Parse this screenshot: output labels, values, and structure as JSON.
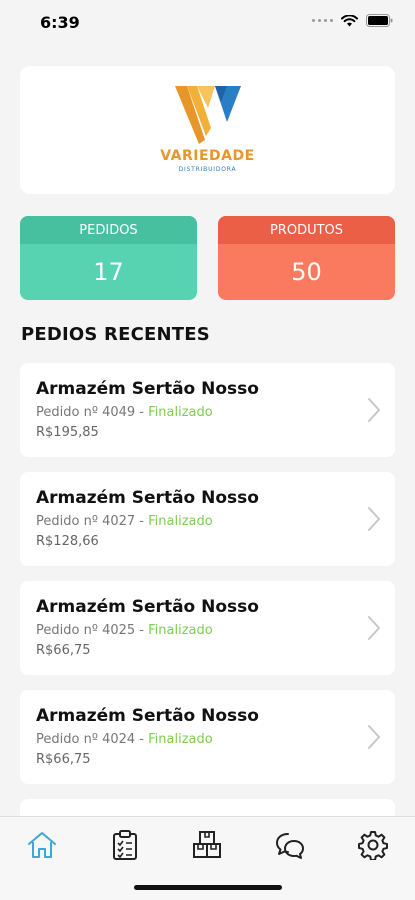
{
  "status_bar": {
    "time": "6:39"
  },
  "brand": {
    "name": "VARIEDADE",
    "subtitle": "DISTRIBUIDORA"
  },
  "stats": {
    "orders": {
      "label": "PEDIDOS",
      "value": "17"
    },
    "products": {
      "label": "PRODUTOS",
      "value": "50"
    }
  },
  "recent": {
    "title": "PEDIOS RECENTES",
    "items": [
      {
        "store": "Armazém Sertão Nosso",
        "order": "Pedido nº 4049",
        "separator": " - ",
        "status": "Finalizado",
        "price": "R$195,85"
      },
      {
        "store": "Armazém Sertão Nosso",
        "order": "Pedido nº 4027",
        "separator": " - ",
        "status": "Finalizado",
        "price": "R$128,66"
      },
      {
        "store": "Armazém Sertão Nosso",
        "order": "Pedido nº 4025",
        "separator": " - ",
        "status": "Finalizado",
        "price": "R$66,75"
      },
      {
        "store": "Armazém Sertão Nosso",
        "order": "Pedido nº 4024",
        "separator": " - ",
        "status": "Finalizado",
        "price": "R$66,75"
      }
    ]
  },
  "tabs": [
    {
      "icon": "home-icon",
      "active": true
    },
    {
      "icon": "clipboard-icon",
      "active": false
    },
    {
      "icon": "boxes-icon",
      "active": false
    },
    {
      "icon": "chat-icon",
      "active": false
    },
    {
      "icon": "gear-icon",
      "active": false
    }
  ],
  "colors": {
    "orders_card": "#58d3b2",
    "products_card": "#fa7a60",
    "status_finalized": "#7fcc52",
    "active_tab": "#3ba8d8",
    "brand_orange": "#e8962a",
    "brand_blue": "#2a7fc4"
  }
}
